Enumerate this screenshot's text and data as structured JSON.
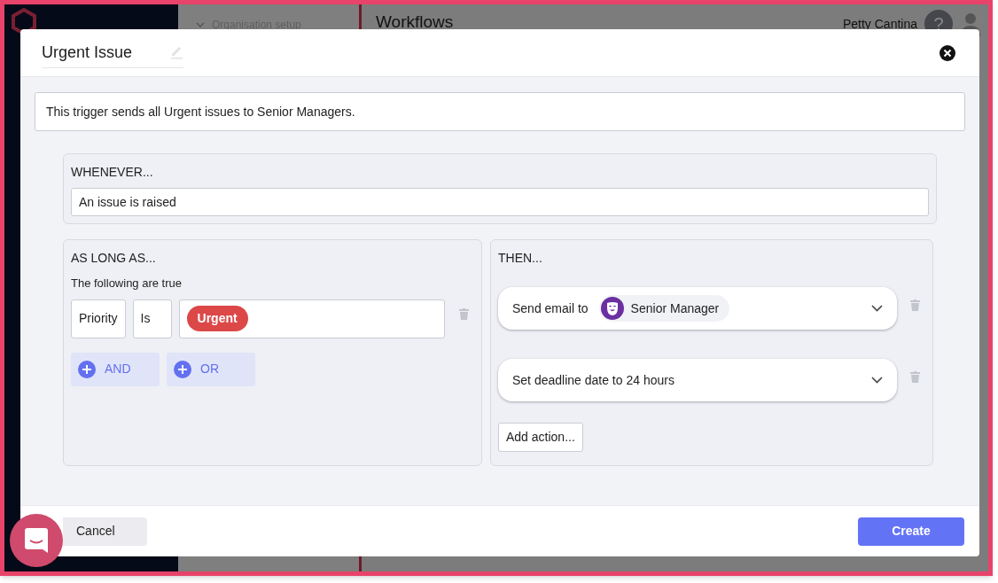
{
  "background": {
    "nav_section": "Organisation setup",
    "page_title": "Workflows",
    "user_name": "Petty Cantina",
    "help_icon": "?"
  },
  "modal": {
    "title": "Urgent Issue",
    "description": "This trigger sends all Urgent issues to Senior Managers.",
    "whenever": {
      "heading": "WHENEVER...",
      "value": "An issue is raised"
    },
    "conditions": {
      "heading": "AS LONG AS...",
      "subtitle": "The following are true",
      "rows": [
        {
          "field": "Priority",
          "operator": "Is",
          "value": "Urgent",
          "color": "#dc4848"
        }
      ],
      "buttons": [
        "AND",
        "OR"
      ]
    },
    "actions": {
      "heading": "THEN...",
      "items": [
        {
          "kind": "email",
          "label": "Send email to",
          "recipient": "Senior Manager"
        },
        {
          "kind": "deadline",
          "label": "Set deadline date to 24 hours"
        }
      ],
      "add_button": "Add action..."
    },
    "cancel": "Cancel",
    "create": "Create"
  }
}
